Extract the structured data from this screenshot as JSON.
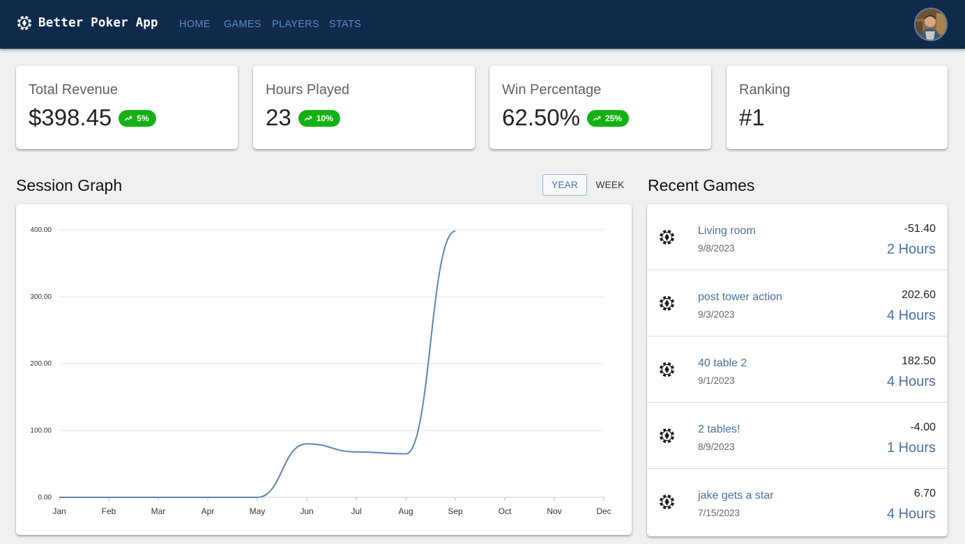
{
  "app": {
    "title": "Better Poker App",
    "nav": [
      "HOME",
      "GAMES",
      "PLAYERS",
      "STATS"
    ]
  },
  "stats": [
    {
      "label": "Total Revenue",
      "value": "$398.45",
      "badge": "5%",
      "trend": "up"
    },
    {
      "label": "Hours Played",
      "value": "23",
      "badge": "10%",
      "trend": "up"
    },
    {
      "label": "Win Percentage",
      "value": "62.50%",
      "badge": "25%",
      "trend": "up"
    },
    {
      "label": "Ranking",
      "value": "#1"
    }
  ],
  "session_graph": {
    "title": "Session Graph",
    "toggle_year": "YEAR",
    "toggle_week": "WEEK",
    "selected": "YEAR"
  },
  "chart_data": {
    "type": "line",
    "title": "",
    "xlabel": "",
    "ylabel": "",
    "x": [
      "Jan",
      "Feb",
      "Mar",
      "Apr",
      "May",
      "Jun",
      "Jul",
      "Aug",
      "Sep",
      "Oct",
      "Nov",
      "Dec"
    ],
    "y_ticks": [
      "0.00",
      "100.00",
      "200.00",
      "300.00",
      "400.00"
    ],
    "ylim": [
      0,
      400
    ],
    "grid": true,
    "series": [
      {
        "values": [
          0,
          0,
          0,
          0,
          0,
          80,
          68,
          65,
          398,
          null,
          null,
          null
        ]
      }
    ],
    "line_color": "#5b84b5"
  },
  "recent_games": {
    "title": "Recent Games",
    "items": [
      {
        "name": "Living room",
        "date": "9/8/2023",
        "amount": "-51.40",
        "hours": "2 Hours"
      },
      {
        "name": "post tower action",
        "date": "9/3/2023",
        "amount": "202.60",
        "hours": "4 Hours"
      },
      {
        "name": "40 table 2",
        "date": "9/1/2023",
        "amount": "182.50",
        "hours": "4 Hours"
      },
      {
        "name": "2 tables!",
        "date": "8/9/2023",
        "amount": "-4.00",
        "hours": "1 Hours"
      },
      {
        "name": "jake gets a star",
        "date": "7/15/2023",
        "amount": "6.70",
        "hours": "4 Hours"
      }
    ]
  },
  "colors": {
    "appbar": "#102a4c",
    "nav_link": "#5d87bd",
    "badge_green": "#14b114",
    "link_blue": "#4a6fa5"
  },
  "icons": {
    "brand": "poker-chip-icon",
    "badge": "trending-up-icon",
    "game": "poker-chip-icon"
  }
}
